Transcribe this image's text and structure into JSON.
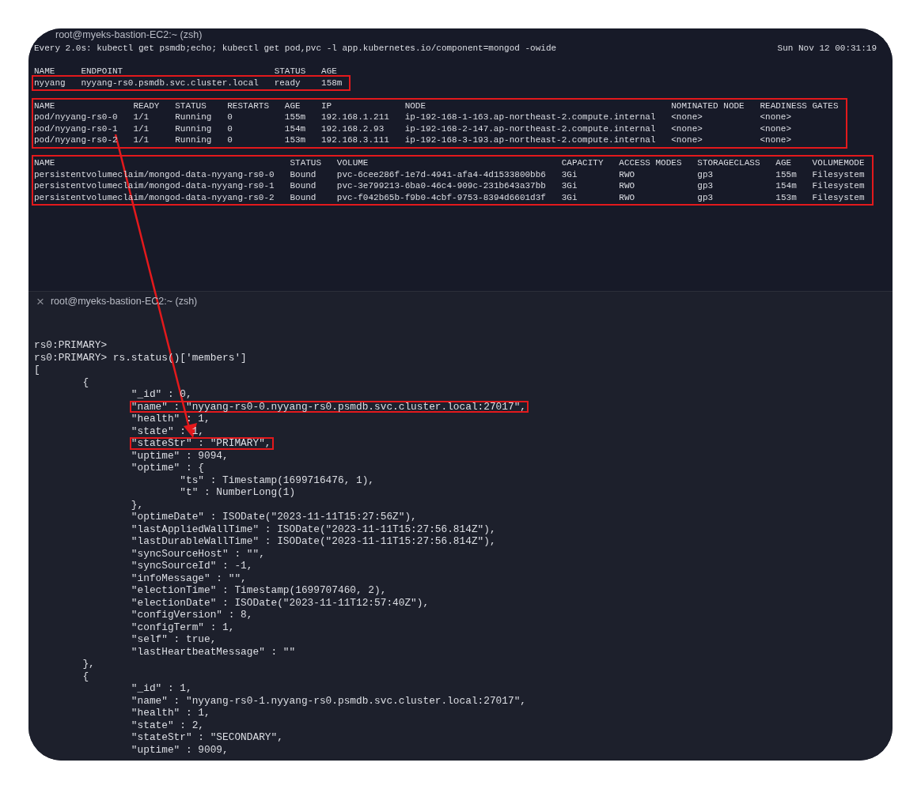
{
  "top_pane": {
    "title": "root@myeks-bastion-EC2:~ (zsh)",
    "command": "Every 2.0s: kubectl get psmdb;echo; kubectl get pod,pvc -l app.kubernetes.io/component=mongod -owide",
    "clock": "Sun Nov 12 00:31:19",
    "tables": [
      {
        "highlighted": false,
        "columns": [
          "NAME",
          "ENDPOINT",
          "STATUS",
          "AGE"
        ],
        "rows": [
          {
            "highlighted": true,
            "cells": [
              "nyyang",
              "nyyang-rs0.psmdb.svc.cluster.local",
              "ready",
              "158m"
            ]
          }
        ]
      },
      {
        "highlighted": true,
        "columns": [
          "NAME",
          "READY",
          "STATUS",
          "RESTARTS",
          "AGE",
          "IP",
          "NODE",
          "NOMINATED NODE",
          "READINESS GATES"
        ],
        "rows": [
          {
            "highlighted": false,
            "cells": [
              "pod/nyyang-rs0-0",
              "1/1",
              "Running",
              "0",
              "155m",
              "192.168.1.211",
              "ip-192-168-1-163.ap-northeast-2.compute.internal",
              "<none>",
              "<none>"
            ]
          },
          {
            "highlighted": false,
            "cells": [
              "pod/nyyang-rs0-1",
              "1/1",
              "Running",
              "0",
              "154m",
              "192.168.2.93",
              "ip-192-168-2-147.ap-northeast-2.compute.internal",
              "<none>",
              "<none>"
            ]
          },
          {
            "highlighted": false,
            "cells": [
              "pod/nyyang-rs0-2",
              "1/1",
              "Running",
              "0",
              "153m",
              "192.168.3.111",
              "ip-192-168-3-193.ap-northeast-2.compute.internal",
              "<none>",
              "<none>"
            ]
          }
        ]
      },
      {
        "highlighted": true,
        "columns": [
          "NAME",
          "STATUS",
          "VOLUME",
          "CAPACITY",
          "ACCESS MODES",
          "STORAGECLASS",
          "AGE",
          "VOLUMEMODE"
        ],
        "rows": [
          {
            "highlighted": false,
            "cells": [
              "persistentvolumeclaim/mongod-data-nyyang-rs0-0",
              "Bound",
              "pvc-6cee286f-1e7d-4941-afa4-4d1533800bb6",
              "3Gi",
              "RWO",
              "gp3",
              "155m",
              "Filesystem"
            ]
          },
          {
            "highlighted": false,
            "cells": [
              "persistentvolumeclaim/mongod-data-nyyang-rs0-1",
              "Bound",
              "pvc-3e799213-6ba0-46c4-909c-231b643a37bb",
              "3Gi",
              "RWO",
              "gp3",
              "154m",
              "Filesystem"
            ]
          },
          {
            "highlighted": false,
            "cells": [
              "persistentvolumeclaim/mongod-data-nyyang-rs0-2",
              "Bound",
              "pvc-f042b65b-f9b0-4cbf-9753-8394d6601d3f",
              "3Gi",
              "RWO",
              "gp3",
              "153m",
              "Filesystem"
            ]
          }
        ]
      }
    ]
  },
  "bottom_pane": {
    "title": "root@myeks-bastion-EC2:~ (zsh)",
    "close": "×",
    "lines": [
      {
        "text": "rs0:PRIMARY>",
        "highlighted": false
      },
      {
        "text": "rs0:PRIMARY> rs.status()['members']",
        "highlighted": false
      },
      {
        "text": "[",
        "highlighted": false,
        "children": [
          {
            "text": "{",
            "highlighted": false,
            "children": [
              {
                "text": "\"_id\" : 0,",
                "highlighted": false
              },
              {
                "text": "\"name\" : \"nyyang-rs0-0.nyyang-rs0.psmdb.svc.cluster.local:27017\",",
                "highlighted": true
              },
              {
                "text": "\"health\" : 1,",
                "highlighted": false
              },
              {
                "text": "\"state\" : 1,",
                "highlighted": false
              },
              {
                "text": "\"stateStr\" : \"PRIMARY\",",
                "highlighted": true
              },
              {
                "text": "\"uptime\" : 9094,",
                "highlighted": false
              },
              {
                "text": "\"optime\" : {",
                "highlighted": false,
                "children": [
                  {
                    "text": "\"ts\" : Timestamp(1699716476, 1),",
                    "highlighted": false
                  },
                  {
                    "text": "\"t\" : NumberLong(1)",
                    "highlighted": false
                  }
                ]
              },
              {
                "text": "},",
                "highlighted": false
              },
              {
                "text": "\"optimeDate\" : ISODate(\"2023-11-11T15:27:56Z\"),",
                "highlighted": false
              },
              {
                "text": "\"lastAppliedWallTime\" : ISODate(\"2023-11-11T15:27:56.814Z\"),",
                "highlighted": false
              },
              {
                "text": "\"lastDurableWallTime\" : ISODate(\"2023-11-11T15:27:56.814Z\"),",
                "highlighted": false
              },
              {
                "text": "\"syncSourceHost\" : \"\",",
                "highlighted": false
              },
              {
                "text": "\"syncSourceId\" : -1,",
                "highlighted": false
              },
              {
                "text": "\"infoMessage\" : \"\",",
                "highlighted": false
              },
              {
                "text": "\"electionTime\" : Timestamp(1699707460, 2),",
                "highlighted": false
              },
              {
                "text": "\"electionDate\" : ISODate(\"2023-11-11T12:57:40Z\"),",
                "highlighted": false
              },
              {
                "text": "\"configVersion\" : 8,",
                "highlighted": false
              },
              {
                "text": "\"configTerm\" : 1,",
                "highlighted": false
              },
              {
                "text": "\"self\" : true,",
                "highlighted": false
              },
              {
                "text": "\"lastHeartbeatMessage\" : \"\"",
                "highlighted": false
              }
            ]
          },
          {
            "text": "},",
            "highlighted": false
          },
          {
            "text": "{",
            "highlighted": false,
            "children": [
              {
                "text": "\"_id\" : 1,",
                "highlighted": false
              },
              {
                "text": "\"name\" : \"nyyang-rs0-1.nyyang-rs0.psmdb.svc.cluster.local:27017\",",
                "highlighted": false
              },
              {
                "text": "\"health\" : 1,",
                "highlighted": false
              },
              {
                "text": "\"state\" : 2,",
                "highlighted": false
              },
              {
                "text": "\"stateStr\" : \"SECONDARY\",",
                "highlighted": false
              },
              {
                "text": "\"uptime\" : 9009,",
                "highlighted": false
              }
            ]
          }
        ]
      }
    ]
  }
}
